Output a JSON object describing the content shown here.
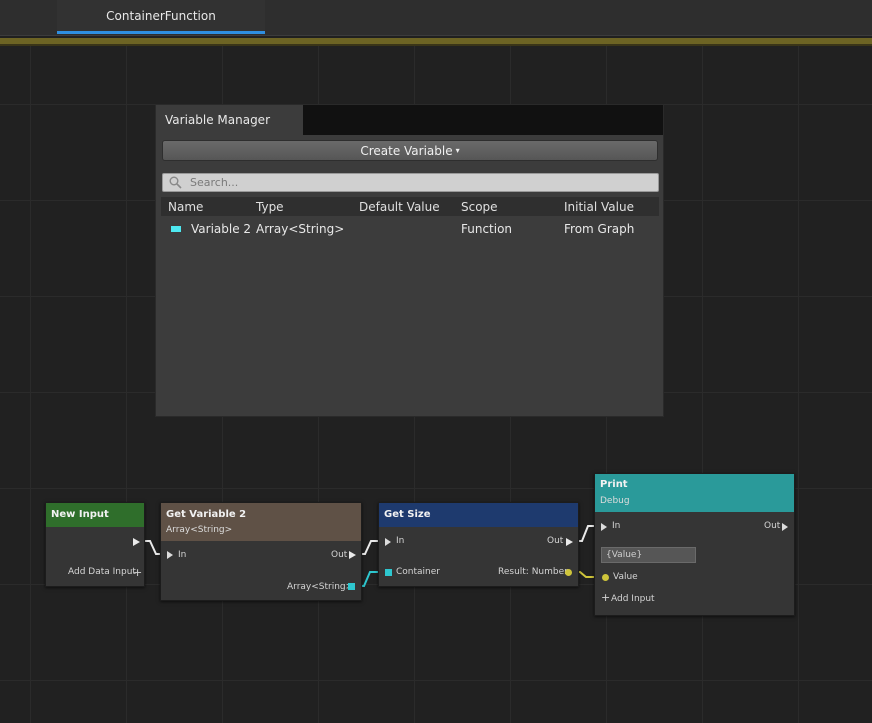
{
  "tab": {
    "label": "ContainerFunction"
  },
  "variable_manager": {
    "title": "Variable Manager",
    "create_button": "Create Variable",
    "caret": "▾",
    "search_placeholder": "Search...",
    "columns": [
      "Name",
      "Type",
      "Default Value",
      "Scope",
      "Initial Value"
    ],
    "rows": [
      {
        "name": "Variable 2",
        "type": "Array<String>",
        "default": "",
        "scope": "Function",
        "initial": "From Graph",
        "color": "#4ee8f0"
      }
    ]
  },
  "nodes": {
    "new_input": {
      "title": "New Input",
      "add_label": "Add Data Input",
      "add_icon": "+",
      "color": "#2f6e2b"
    },
    "get_variable": {
      "title": "Get Variable 2",
      "subtitle": "Array<String>",
      "in_label": "In",
      "out_label": "Out",
      "data_out_label": "Array<String>",
      "color": "#5f5146"
    },
    "get_size": {
      "title": "Get Size",
      "in_label": "In",
      "out_label": "Out",
      "container_label": "Container",
      "result_label": "Result: Number",
      "color": "#1e3a6e"
    },
    "print": {
      "title": "Print",
      "subtitle": "Debug",
      "in_label": "In",
      "out_label": "Out",
      "value_field": "{Value}",
      "value_label": "Value",
      "add_input_label": "Add Input",
      "add_icon": "+",
      "color": "#2a9a9a"
    }
  },
  "colors": {
    "exec": "#eaeaea",
    "array": "#2ec7cf",
    "number": "#cfc53b",
    "tab_accent": "#2f8fe0"
  }
}
